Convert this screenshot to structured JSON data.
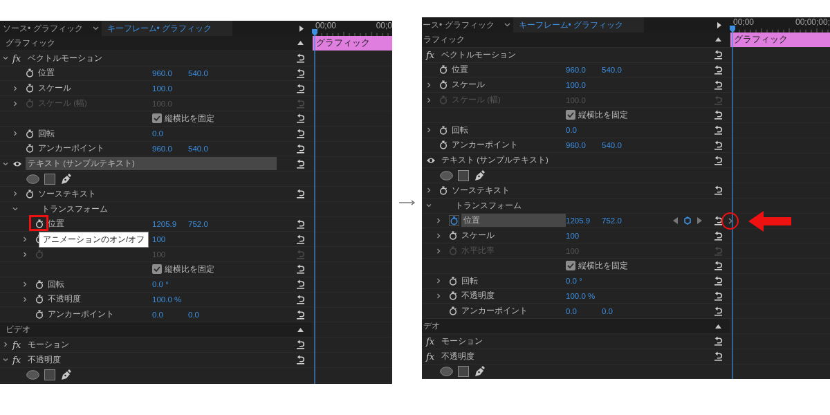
{
  "panels": [
    {
      "tabs": [
        {
          "label": "ソース• グラフィック",
          "selected": false
        },
        {
          "label": "キーフレーム• グラフィック",
          "selected": true
        }
      ],
      "timecodes": [
        "00;00",
        "00;0"
      ],
      "sections": [
        {
          "title": "グラフィック",
          "clip": "グラフィック",
          "items": [
            {
              "kind": "effect",
              "badge": "fx",
              "label": "ベクトルモーション",
              "expanded": true,
              "selected": false,
              "children": [
                {
                  "kind": "property",
                  "label": "位置",
                  "values": [
                    "960.0",
                    "540.0"
                  ],
                  "disabled": false,
                  "animated": false,
                  "selected": false
                },
                {
                  "kind": "property",
                  "label": "スケール",
                  "values": [
                    "100.0"
                  ],
                  "expanded": false,
                  "disabled": false,
                  "animated": false,
                  "selected": false
                },
                {
                  "kind": "property",
                  "label": "スケール (幅)",
                  "values": [
                    "100.0"
                  ],
                  "expanded": false,
                  "disabled": true,
                  "animated": false,
                  "selected": false
                },
                {
                  "kind": "checkbox",
                  "label": "縦横比を固定",
                  "checked": true
                },
                {
                  "kind": "property",
                  "label": "回転",
                  "values": [
                    "0.0"
                  ],
                  "expanded": false,
                  "disabled": false,
                  "animated": false,
                  "selected": false
                },
                {
                  "kind": "property",
                  "label": "アンカーポイント",
                  "values": [
                    "960.0",
                    "540.0"
                  ],
                  "disabled": false,
                  "animated": false,
                  "selected": false
                }
              ]
            },
            {
              "kind": "effect",
              "visible": true,
              "label": "テキスト (サンプルテキスト)",
              "expanded": true,
              "selected": true,
              "children": [
                {
                  "kind": "tools"
                },
                {
                  "kind": "property",
                  "label": "ソーステキスト",
                  "expanded": false,
                  "disabled": false,
                  "animated": false,
                  "selected": false
                },
                {
                  "kind": "group",
                  "label": "トランスフォーム",
                  "expanded": true,
                  "children": [
                    {
                      "kind": "property",
                      "label": "位置",
                      "values": [
                        "1205.9",
                        "752.0"
                      ],
                      "disabled": false,
                      "animated": false,
                      "selected": false,
                      "callout_box": true,
                      "tooltip": "アニメーションのオン/オフ"
                    },
                    {
                      "kind": "property",
                      "values": [
                        "100"
                      ],
                      "expanded": false,
                      "disabled": false,
                      "animated": false,
                      "selected": false
                    },
                    {
                      "kind": "property",
                      "values": [
                        "100"
                      ],
                      "expanded": false,
                      "disabled": true,
                      "animated": false,
                      "selected": false
                    },
                    {
                      "kind": "checkbox",
                      "label": "縦横比を固定",
                      "checked": true
                    },
                    {
                      "kind": "property",
                      "label": "回転",
                      "values": [
                        "0.0 °"
                      ],
                      "expanded": false,
                      "disabled": false,
                      "animated": false,
                      "selected": false
                    },
                    {
                      "kind": "property",
                      "label": "不透明度",
                      "values": [
                        "100.0 %"
                      ],
                      "expanded": false,
                      "disabled": false,
                      "animated": false,
                      "selected": false
                    },
                    {
                      "kind": "property",
                      "label": "アンカーポイント",
                      "values": [
                        "0.0",
                        "0.0"
                      ],
                      "disabled": false,
                      "animated": false,
                      "selected": false
                    }
                  ]
                }
              ]
            }
          ]
        },
        {
          "title": "ビデオ",
          "items": [
            {
              "kind": "effect",
              "badge": "fx",
              "label": "モーション",
              "expanded": false,
              "selected": false
            },
            {
              "kind": "effect",
              "badge": "fx",
              "label": "不透明度",
              "expanded": true,
              "selected": false,
              "children": [
                {
                  "kind": "tools"
                }
              ]
            }
          ]
        }
      ]
    },
    {
      "tabs": [
        {
          "label": "ース• グラフィック",
          "selected": false
        },
        {
          "label": "キーフレーム• グラフィック",
          "selected": true
        }
      ],
      "timecodes": [
        "00;00",
        "00;00;00;"
      ],
      "sections": [
        {
          "title": "ラフィック",
          "clip": "グラフィック",
          "items": [
            {
              "kind": "effect",
              "badge": "fx",
              "label": "ベクトルモーション",
              "selected": false,
              "children": [
                {
                  "kind": "property",
                  "label": "位置",
                  "values": [
                    "960.0",
                    "540.0"
                  ],
                  "disabled": false,
                  "animated": false,
                  "selected": false
                },
                {
                  "kind": "property",
                  "label": "スケール",
                  "values": [
                    "100.0"
                  ],
                  "expanded": false,
                  "disabled": false,
                  "animated": false,
                  "selected": false
                },
                {
                  "kind": "property",
                  "label": "スケール (幅)",
                  "values": [
                    "100.0"
                  ],
                  "expanded": false,
                  "disabled": true,
                  "animated": false,
                  "selected": false
                },
                {
                  "kind": "checkbox",
                  "label": "縦横比を固定",
                  "checked": true
                },
                {
                  "kind": "property",
                  "label": "回転",
                  "values": [
                    "0.0"
                  ],
                  "expanded": false,
                  "disabled": false,
                  "animated": false,
                  "selected": false
                },
                {
                  "kind": "property",
                  "label": "アンカーポイント",
                  "values": [
                    "960.0",
                    "540.0"
                  ],
                  "disabled": false,
                  "animated": false,
                  "selected": false
                }
              ]
            },
            {
              "kind": "effect",
              "visible": true,
              "label": "テキスト (サンプルテキスト)",
              "selected": false,
              "children": [
                {
                  "kind": "tools"
                },
                {
                  "kind": "property",
                  "label": "ソーステキスト",
                  "expanded": false,
                  "disabled": false,
                  "animated": false,
                  "selected": false
                },
                {
                  "kind": "group",
                  "label": "トランスフォーム",
                  "expanded": true,
                  "children": [
                    {
                      "kind": "property",
                      "label": "位置",
                      "values": [
                        "1205.9",
                        "752.0"
                      ],
                      "expanded": false,
                      "disabled": false,
                      "animated": true,
                      "selected": true,
                      "keyframe_nav": true,
                      "callout_circle": true
                    },
                    {
                      "kind": "property",
                      "label": "スケール",
                      "values": [
                        "100"
                      ],
                      "expanded": false,
                      "disabled": false,
                      "animated": false,
                      "selected": false
                    },
                    {
                      "kind": "property",
                      "label": "水平比率",
                      "values": [
                        "100"
                      ],
                      "expanded": false,
                      "disabled": true,
                      "animated": false,
                      "selected": false
                    },
                    {
                      "kind": "checkbox",
                      "label": "縦横比を固定",
                      "checked": true
                    },
                    {
                      "kind": "property",
                      "label": "回転",
                      "values": [
                        "0.0 °"
                      ],
                      "expanded": false,
                      "disabled": false,
                      "animated": false,
                      "selected": false
                    },
                    {
                      "kind": "property",
                      "label": "不透明度",
                      "values": [
                        "100.0 %"
                      ],
                      "expanded": false,
                      "disabled": false,
                      "animated": false,
                      "selected": false
                    },
                    {
                      "kind": "property",
                      "label": "アンカーポイント",
                      "values": [
                        "0.0",
                        "0.0"
                      ],
                      "disabled": false,
                      "animated": false,
                      "selected": false
                    }
                  ]
                }
              ]
            }
          ]
        },
        {
          "title": "デオ",
          "items": [
            {
              "kind": "effect",
              "badge": "fx",
              "label": "モーション",
              "selected": false
            },
            {
              "kind": "effect",
              "badge": "fx",
              "label": "不透明度",
              "selected": false,
              "children": [
                {
                  "kind": "tools"
                }
              ]
            }
          ]
        }
      ]
    }
  ]
}
